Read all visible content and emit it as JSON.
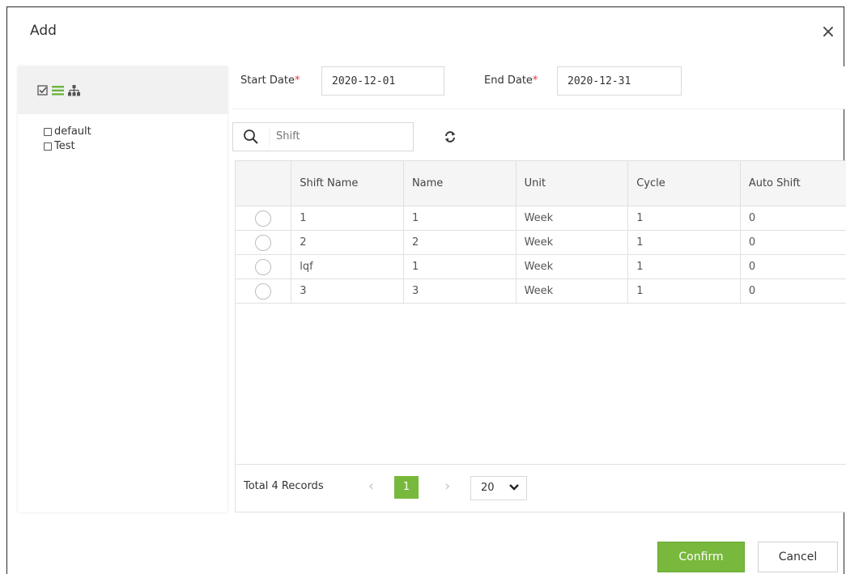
{
  "dialog": {
    "title": "Add",
    "close_label": "×"
  },
  "tree": {
    "items": [
      {
        "label": "default"
      },
      {
        "label": "Test"
      }
    ]
  },
  "filters": {
    "start_label": "Start Date",
    "start_value": "2020-12-01",
    "end_label": "End Date",
    "end_value": "2020-12-31",
    "required_mark": "*",
    "search_placeholder": "Shift"
  },
  "table": {
    "columns": [
      "Shift Name",
      "Name",
      "Unit",
      "Cycle",
      "Auto Shift"
    ],
    "rows": [
      [
        "1",
        "1",
        "Week",
        "1",
        "0"
      ],
      [
        "2",
        "2",
        "Week",
        "1",
        "0"
      ],
      [
        "lqf",
        "1",
        "Week",
        "1",
        "0"
      ],
      [
        "3",
        "3",
        "Week",
        "1",
        "0"
      ]
    ]
  },
  "pager": {
    "total_text": "Total 4 Records",
    "prev": "‹",
    "next": "›",
    "current_page": "1",
    "page_size": "20"
  },
  "footer": {
    "confirm_label": "Confirm",
    "cancel_label": "Cancel"
  },
  "colors": {
    "accent_green": "#78b83c",
    "required_red": "#e53935",
    "header_bg": "#f5f5f5"
  },
  "icons": [
    "close-icon",
    "check-all-icon",
    "list-icon",
    "org-tree-icon",
    "search-icon",
    "refresh-icon",
    "chevron-down-icon"
  ]
}
